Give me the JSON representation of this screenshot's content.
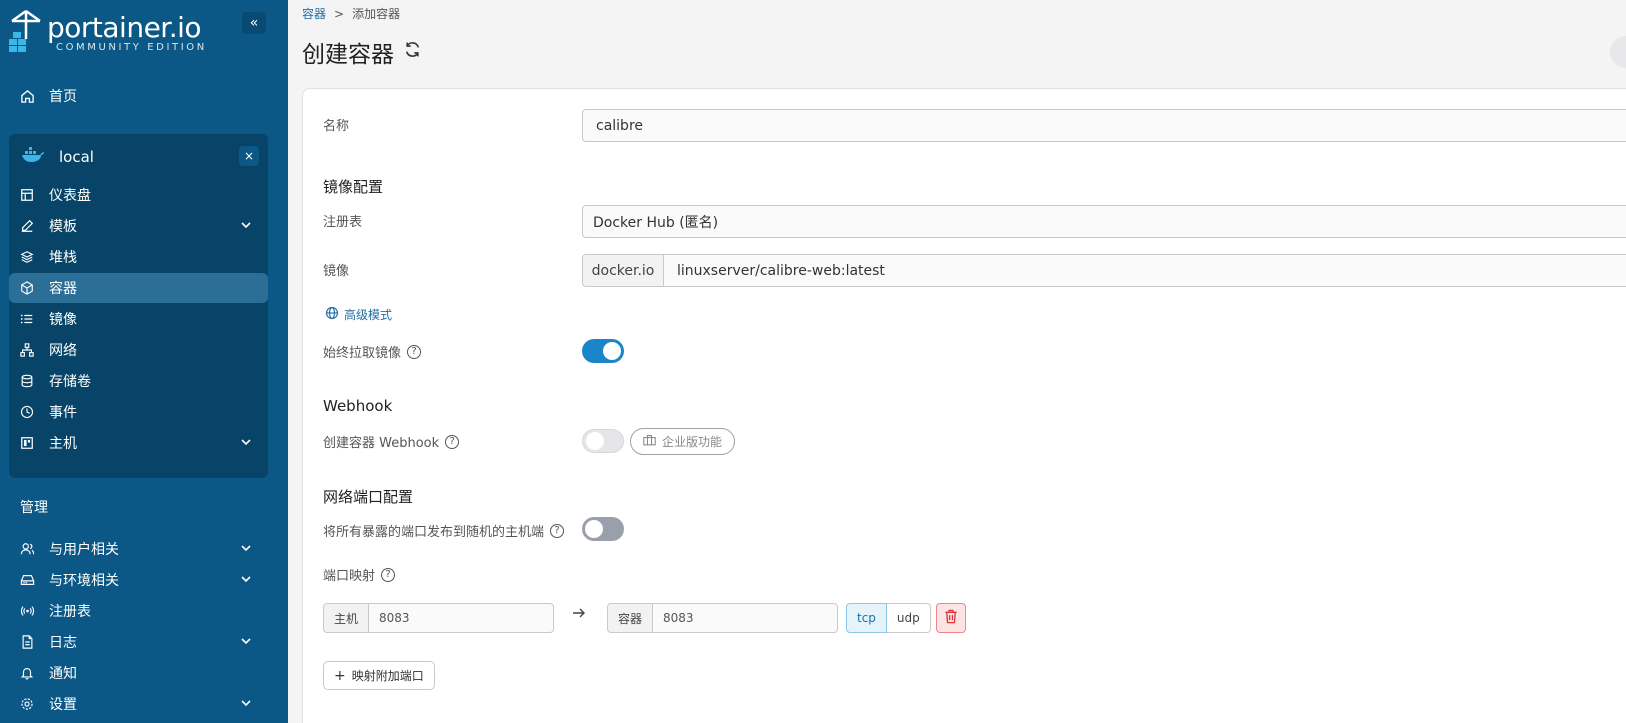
{
  "logo": {
    "name": "portainer.io",
    "edition": "COMMUNITY EDITION"
  },
  "sidebar": {
    "collapse_label": "«",
    "home": "首页",
    "environment": {
      "name": "local",
      "close_label": "×"
    },
    "env_items": [
      {
        "label": "仪表盘",
        "icon": "dashboard-icon"
      },
      {
        "label": "模板",
        "icon": "edit-icon",
        "expandable": true
      },
      {
        "label": "堆栈",
        "icon": "layers-icon"
      },
      {
        "label": "容器",
        "icon": "cube-icon",
        "active": true
      },
      {
        "label": "镜像",
        "icon": "list-icon"
      },
      {
        "label": "网络",
        "icon": "network-icon"
      },
      {
        "label": "存储卷",
        "icon": "database-icon"
      },
      {
        "label": "事件",
        "icon": "clock-icon"
      },
      {
        "label": "主机",
        "icon": "host-icon",
        "expandable": true
      }
    ],
    "admin_title": "管理",
    "admin_items": [
      {
        "label": "与用户相关",
        "icon": "users-icon",
        "expandable": true
      },
      {
        "label": "与环境相关",
        "icon": "drive-icon",
        "expandable": true
      },
      {
        "label": "注册表",
        "icon": "radio-icon"
      },
      {
        "label": "日志",
        "icon": "file-icon",
        "expandable": true
      },
      {
        "label": "通知",
        "icon": "bell-icon"
      },
      {
        "label": "设置",
        "icon": "settings-icon",
        "expandable": true
      }
    ]
  },
  "breadcrumb": {
    "parent": "容器",
    "separator": ">",
    "current": "添加容器"
  },
  "page": {
    "title": "创建容器"
  },
  "form": {
    "name_label": "名称",
    "name_value": "calibre",
    "image_section": "镜像配置",
    "registry_label": "注册表",
    "registry_value": "Docker Hub (匿名)",
    "image_label": "镜像",
    "image_prefix": "docker.io",
    "image_value": "linuxserver/calibre-web:latest",
    "advanced_link": "高级模式",
    "always_pull_label": "始终拉取镜像",
    "always_pull_on": true,
    "webhook_section": "Webhook",
    "webhook_label": "创建容器 Webhook",
    "enterprise_badge": "企业版功能",
    "network_section": "网络端口配置",
    "publish_all_label": "将所有暴露的端口发布到随机的主机端",
    "port_mapping_label": "端口映射",
    "host_addon": "主机",
    "host_port": "8083",
    "container_addon": "容器",
    "container_port": "8083",
    "protocol_tcp": "tcp",
    "protocol_udp": "udp",
    "add_port_label": "映射附加端口"
  },
  "colors": {
    "sidebar": "#0b5785",
    "accent": "#1a85c8",
    "danger": "#e55353"
  }
}
